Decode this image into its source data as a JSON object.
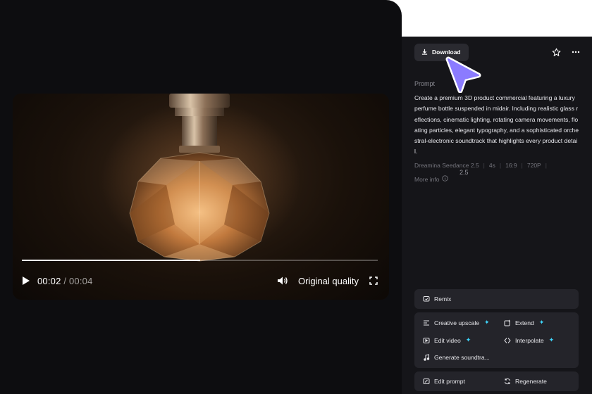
{
  "video": {
    "current_time": "00:02",
    "total_time": "/ 00:04",
    "progress": 0.5,
    "quality_label": "Original quality"
  },
  "panel": {
    "download_label": "Download",
    "prompt_label": "Prompt",
    "prompt_text": "Create a premium 3D product commercial featuring a luxury perfume bottle suspended in midair. Including realistic glass reflections, cinematic lighting, rotating camera movements, floating particles, elegant typography, and a sophisticated orchestral-electronic soundtrack that highlights every product detail.",
    "meta": {
      "model": "Dreamina Seedance 2.5",
      "duration": "4s",
      "ratio": "16:9",
      "resolution": "720P",
      "badge": "2.5"
    },
    "more_info_label": "More info"
  },
  "actions": {
    "remix": "Remix",
    "creative_upscale": "Creative upscale",
    "extend": "Extend",
    "edit_video": "Edit video",
    "interpolate": "Interpolate",
    "generate_soundtrack": "Generate soundtra...",
    "edit_prompt": "Edit prompt",
    "regenerate": "Regenerate"
  },
  "colors": {
    "accent_sparkle": "#3fd8ff",
    "cursor": "#8b7bff",
    "panel_bg": "#151519",
    "page_bg": "#0d0d10"
  },
  "icons": {
    "play": "play-icon",
    "volume": "volume-icon",
    "fullscreen": "fullscreen-icon",
    "download": "download-icon",
    "favorite": "star-icon",
    "more": "more-icon",
    "info": "info-icon"
  }
}
